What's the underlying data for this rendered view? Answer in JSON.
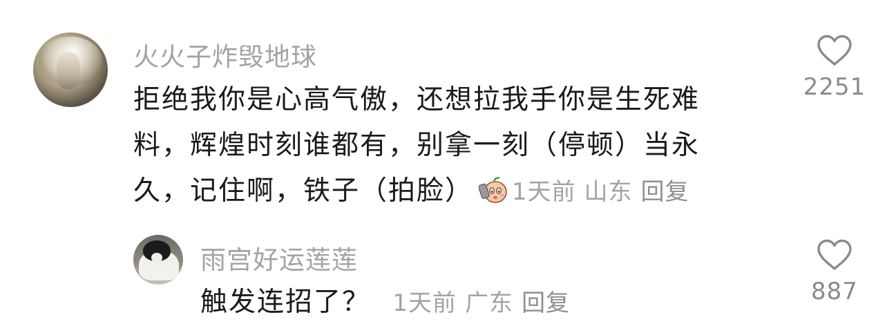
{
  "comments": [
    {
      "username": "火火子炸毁地球",
      "text_lines": [
        "拒绝我你是心高气傲，还想拉我手你是生死难",
        "料，辉煌时刻谁都有，别拿一刻（停顿）当永",
        "久，记住啊，铁子（拍脸）"
      ],
      "emoji": "slap-face-emoji",
      "time": "1天前",
      "location": "山东",
      "reply_label": "回复",
      "likes": "2251"
    },
    {
      "username": "雨宫好运莲莲",
      "text": "触发连招了？",
      "time": "1天前",
      "location": "广东",
      "reply_label": "回复",
      "likes": "887"
    }
  ],
  "icons": {
    "like": "heart-outline-icon"
  },
  "colors": {
    "text": "#1a1a1a",
    "muted": "#a3a3a3",
    "icon": "#8a8a8a",
    "background": "#ffffff"
  }
}
